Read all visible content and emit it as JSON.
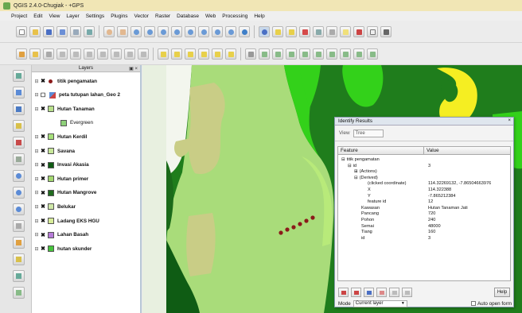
{
  "window": {
    "title": "QGIS 2.4.0-Chugiak - +GPS"
  },
  "menu": [
    "Project",
    "Edit",
    "View",
    "Layer",
    "Settings",
    "Plugins",
    "Vector",
    "Raster",
    "Database",
    "Web",
    "Processing",
    "Help"
  ],
  "layers_panel": {
    "title": "Layers",
    "controls": "▣ ×",
    "items": [
      {
        "name": "titik pengamatan",
        "kind": "point",
        "color": "#8b1a1a",
        "checked": true
      },
      {
        "name": "peta tutupan lahan_Geo 2",
        "kind": "raster",
        "color": "#5b8bd6",
        "checked": false
      },
      {
        "name": "Hutan Tanaman",
        "kind": "polygon",
        "color": "#b8e08a",
        "checked": true
      },
      {
        "name": "Evergreen",
        "kind": "polygon",
        "color": "#8fd17a",
        "checked": true,
        "sub": true
      },
      {
        "name": "Hutan Kerdil",
        "kind": "polygon",
        "color": "#a6e07a",
        "checked": true
      },
      {
        "name": "Savana",
        "kind": "polygon",
        "color": "#c8e89a",
        "checked": true
      },
      {
        "name": "Invasi Akasia",
        "kind": "polygon",
        "color": "#0f5c14",
        "checked": true
      },
      {
        "name": "Hutan primer",
        "kind": "polygon",
        "color": "#a3d86f",
        "checked": true
      },
      {
        "name": "Hutan Mangrove",
        "kind": "polygon",
        "color": "#206b1e",
        "checked": true
      },
      {
        "name": "Belukar",
        "kind": "polygon",
        "color": "#cfe8a8",
        "checked": true
      },
      {
        "name": "Ladang EKS HGU",
        "kind": "polygon",
        "color": "#d8ed9a",
        "checked": true
      },
      {
        "name": "Lahan Basah",
        "kind": "polygon",
        "color": "#b67bd8",
        "checked": true
      },
      {
        "name": "hutan skunder",
        "kind": "polygon",
        "color": "#46c43c",
        "checked": true
      }
    ]
  },
  "identify": {
    "title": "Identify Results",
    "close": "×",
    "view_label": "View",
    "view_value": "Tree",
    "col_feature": "Feature",
    "col_value": "Value",
    "rows": [
      {
        "indent": 0,
        "exp": "⊟",
        "feature": "titik pengamatan",
        "value": ""
      },
      {
        "indent": 1,
        "exp": "⊟",
        "feature": "id",
        "value": "3"
      },
      {
        "indent": 2,
        "exp": "⊞",
        "feature": "(Actions)",
        "value": ""
      },
      {
        "indent": 2,
        "exp": "⊟",
        "feature": "(Derived)",
        "value": ""
      },
      {
        "indent": 3,
        "exp": "",
        "feature": "(clicked coordinate)",
        "value": "114.32269132, -7.86504663976"
      },
      {
        "indent": 3,
        "exp": "",
        "feature": "X",
        "value": "114.322388"
      },
      {
        "indent": 3,
        "exp": "",
        "feature": "Y",
        "value": "-7.865212384"
      },
      {
        "indent": 3,
        "exp": "",
        "feature": "feature id",
        "value": "12"
      },
      {
        "indent": 2,
        "exp": "",
        "feature": "Kawasan",
        "value": "Hutan Tanaman Jati"
      },
      {
        "indent": 2,
        "exp": "",
        "feature": "Pancang",
        "value": "720"
      },
      {
        "indent": 2,
        "exp": "",
        "feature": "Pohon",
        "value": "240"
      },
      {
        "indent": 2,
        "exp": "",
        "feature": "Semai",
        "value": "48000"
      },
      {
        "indent": 2,
        "exp": "",
        "feature": "Tiang",
        "value": "160"
      },
      {
        "indent": 2,
        "exp": "",
        "feature": "id",
        "value": "3"
      }
    ],
    "help_label": "Help",
    "mode_label": "Mode",
    "mode_value": "Current layer",
    "auto_open_label": "Auto open form"
  },
  "colors": {
    "accent_green": "#1e7a1e",
    "bright_green": "#33d11a",
    "pale_green": "#a9dc7a",
    "khaki": "#c9cd86",
    "yellow": "#f5ee22",
    "point_red": "#8b1a1a"
  }
}
